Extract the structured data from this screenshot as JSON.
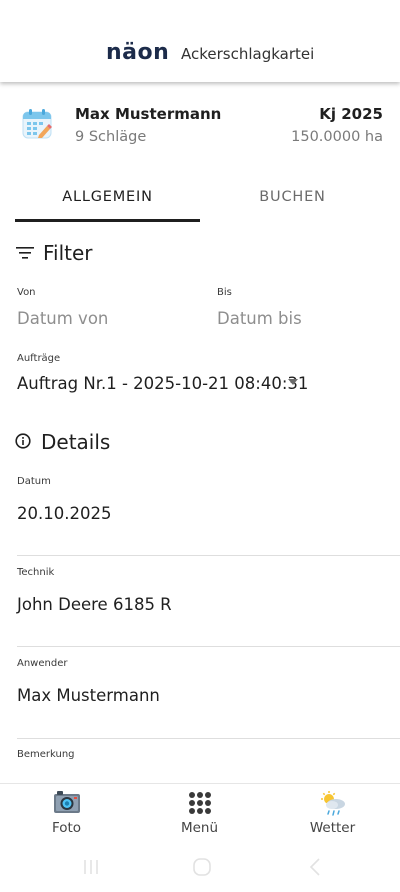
{
  "header": {
    "logo": "näon",
    "title": "Ackerschlagkartei"
  },
  "farm": {
    "name": "Max Mustermann",
    "fields": "9 Schläge",
    "year": "Kj 2025",
    "area": "150.0000 ha",
    "icon": "calendar-icon"
  },
  "tabs": [
    {
      "label": "ALLGEMEIN",
      "active": true
    },
    {
      "label": "BUCHEN",
      "active": false
    }
  ],
  "filter": {
    "title": "Filter",
    "icon": "filter-icon",
    "from_label": "Von",
    "from_placeholder": "Datum von",
    "to_label": "Bis",
    "to_placeholder": "Datum bis",
    "orders_label": "Aufträge",
    "orders_value": "Auftrag Nr.1 - 2025-10-21 08:40:31"
  },
  "details": {
    "title": "Details",
    "icon": "info-icon",
    "fields": [
      {
        "label": "Datum",
        "value": "20.10.2025"
      },
      {
        "label": "Technik",
        "value": "John Deere 6185 R"
      },
      {
        "label": "Anwender",
        "value": "Max Mustermann"
      },
      {
        "label": "Bemerkung",
        "value": ""
      }
    ]
  },
  "bottom_nav": [
    {
      "label": "Foto",
      "icon": "camera-icon"
    },
    {
      "label": "Menü",
      "icon": "grid-menu-icon"
    },
    {
      "label": "Wetter",
      "icon": "weather-icon"
    }
  ],
  "colors": {
    "brand": "#1c2b4a",
    "text": "#1f1f1f",
    "muted": "#7a7a7a",
    "divider": "#dedede"
  }
}
